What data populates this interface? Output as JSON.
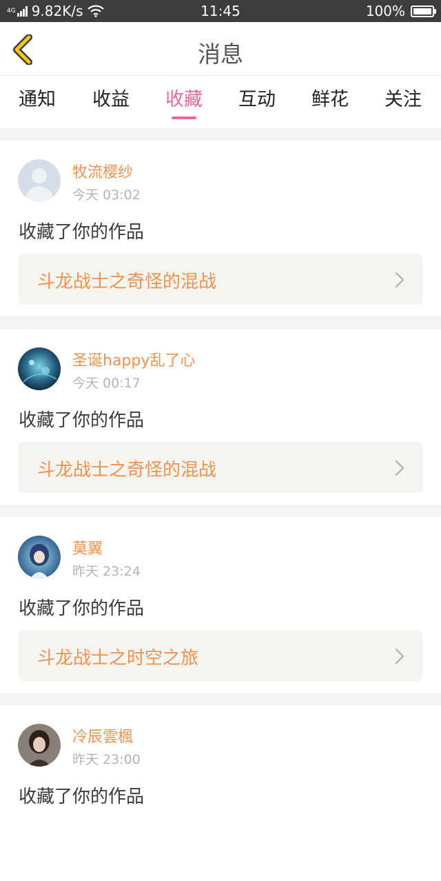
{
  "status_bar": {
    "network_type": "4G",
    "speed": "9.82K/s",
    "time": "11:45",
    "battery": "100%",
    "battery_level": 1.0,
    "icons": [
      "signal-icon",
      "wifi-icon",
      "battery-icon"
    ]
  },
  "header": {
    "back_icon": "chevron-left-icon",
    "title": "消息"
  },
  "tabs": [
    {
      "label": "通知",
      "active": false
    },
    {
      "label": "收益",
      "active": false
    },
    {
      "label": "收藏",
      "active": true
    },
    {
      "label": "互动",
      "active": false
    },
    {
      "label": "鲜花",
      "active": false
    },
    {
      "label": "关注",
      "active": false
    }
  ],
  "colors": {
    "accent_pink": "#e56a9f",
    "username_orange": "#f0914f",
    "back_yellow": "#f5c518",
    "work_bg": "#f5f4ef"
  },
  "messages": [
    {
      "username": "牧流樱纱",
      "time": "今天 03:02",
      "action": "收藏了你的作品",
      "work_title": "斗龙战士之奇怪的混战",
      "avatar": "default-avatar-icon"
    },
    {
      "username": "圣诞happy乱了心",
      "time": "今天 00:17",
      "action": "收藏了你的作品",
      "work_title": "斗龙战士之奇怪的混战",
      "avatar": "user-avatar"
    },
    {
      "username": "莫翼",
      "time": "昨天 23:24",
      "action": "收藏了你的作品",
      "work_title": "斗龙战士之时空之旅",
      "avatar": "user-avatar"
    },
    {
      "username": "冷辰雲楓",
      "time": "昨天 23:00",
      "action": "收藏了你的作品",
      "work_title": "",
      "avatar": "user-avatar"
    }
  ]
}
